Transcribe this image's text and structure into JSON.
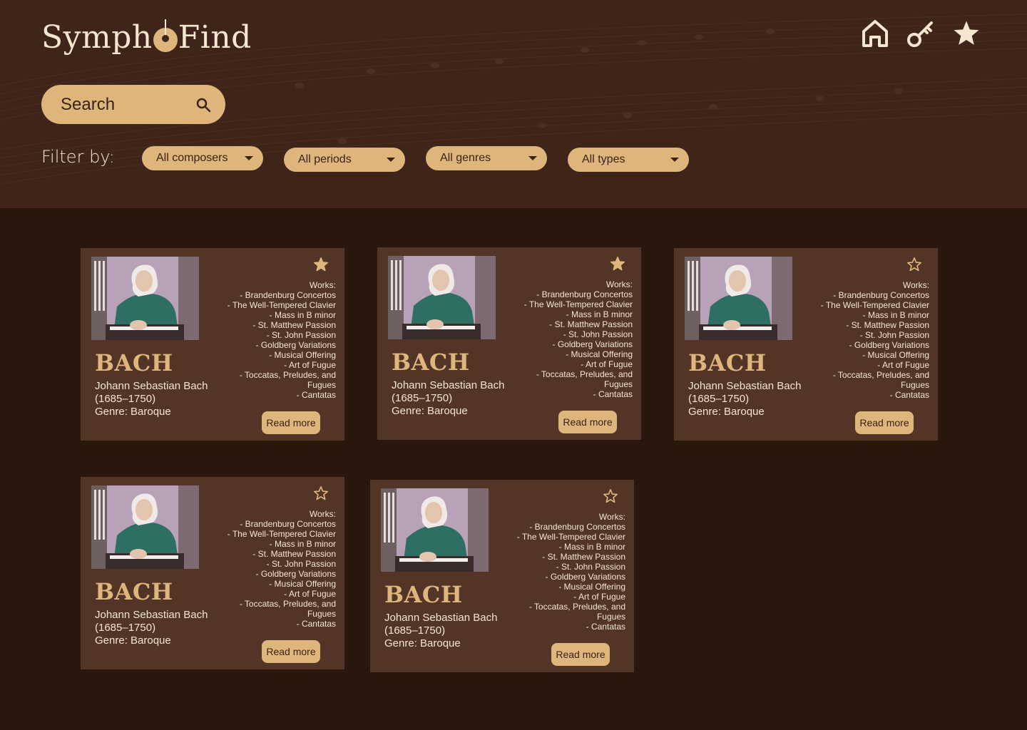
{
  "header": {
    "logo": {
      "left": "Symph",
      "right": "Find"
    },
    "nav": [
      {
        "name": "home-icon"
      },
      {
        "name": "key-icon"
      },
      {
        "name": "star-icon"
      }
    ]
  },
  "search": {
    "placeholder": "Search"
  },
  "filters": {
    "label": "Filter by:",
    "dropdowns": [
      "All composers",
      "All periods",
      "All genres",
      "All types"
    ]
  },
  "colors": {
    "header_bg": "#3f2519",
    "page_bg": "#2a170c",
    "card_bg": "#523526",
    "accent": "#deb67c",
    "text_light": "#f4e6cf"
  },
  "cards": [
    {
      "name": "BACH",
      "fullname": "Johann Sebastian Bach",
      "dates": "(1685–1750)",
      "genre": "Genre:  Baroque",
      "favorite": true,
      "works_title": "Works:",
      "works": [
        "- Brandenburg Concertos",
        "- The Well-Tempered Clavier",
        "- Mass in B minor",
        "- St. Matthew Passion",
        "- St. John Passion",
        "- Goldberg Variations",
        "- Musical Offering",
        "- Art of Fugue",
        "- Toccatas, Preludes, and",
        "Fugues",
        "- Cantatas"
      ],
      "button": "Read more"
    },
    {
      "name": "BACH",
      "fullname": "Johann Sebastian Bach",
      "dates": "(1685–1750)",
      "genre": "Genre:  Baroque",
      "favorite": true,
      "works_title": "Works:",
      "works": [
        "- Brandenburg Concertos",
        "- The Well-Tempered Clavier",
        "- Mass in B minor",
        "- St. Matthew Passion",
        "- St. John Passion",
        "- Goldberg Variations",
        "- Musical Offering",
        "- Art of Fugue",
        "- Toccatas, Preludes, and",
        "Fugues",
        "- Cantatas"
      ],
      "button": "Read more"
    },
    {
      "name": "BACH",
      "fullname": "Johann Sebastian Bach",
      "dates": "(1685–1750)",
      "genre": "Genre:  Baroque",
      "favorite": false,
      "works_title": "Works:",
      "works": [
        "- Brandenburg Concertos",
        "- The Well-Tempered Clavier",
        "- Mass in B minor",
        "- St. Matthew Passion",
        "- St. John Passion",
        "- Goldberg Variations",
        "- Musical Offering",
        "- Art of Fugue",
        "- Toccatas, Preludes, and",
        "Fugues",
        "- Cantatas"
      ],
      "button": "Read more"
    },
    {
      "name": "BACH",
      "fullname": "Johann Sebastian Bach",
      "dates": "(1685–1750)",
      "genre": "Genre:  Baroque",
      "favorite": false,
      "works_title": "Works:",
      "works": [
        "- Brandenburg Concertos",
        "- The Well-Tempered Clavier",
        "- Mass in B minor",
        "- St. Matthew Passion",
        "- St. John Passion",
        "- Goldberg Variations",
        "- Musical Offering",
        "- Art of Fugue",
        "- Toccatas, Preludes, and",
        "Fugues",
        "- Cantatas"
      ],
      "button": "Read more"
    },
    {
      "name": "BACH",
      "fullname": "Johann Sebastian Bach",
      "dates": "(1685–1750)",
      "genre": "Genre:  Baroque",
      "favorite": false,
      "works_title": "Works:",
      "works": [
        "- Brandenburg Concertos",
        "- The Well-Tempered Clavier",
        "- Mass in B minor",
        "- St. Matthew Passion",
        "- St. John Passion",
        "- Goldberg Variations",
        "- Musical Offering",
        "- Art of Fugue",
        "- Toccatas, Preludes, and",
        "Fugues",
        "- Cantatas"
      ],
      "button": "Read more"
    }
  ]
}
